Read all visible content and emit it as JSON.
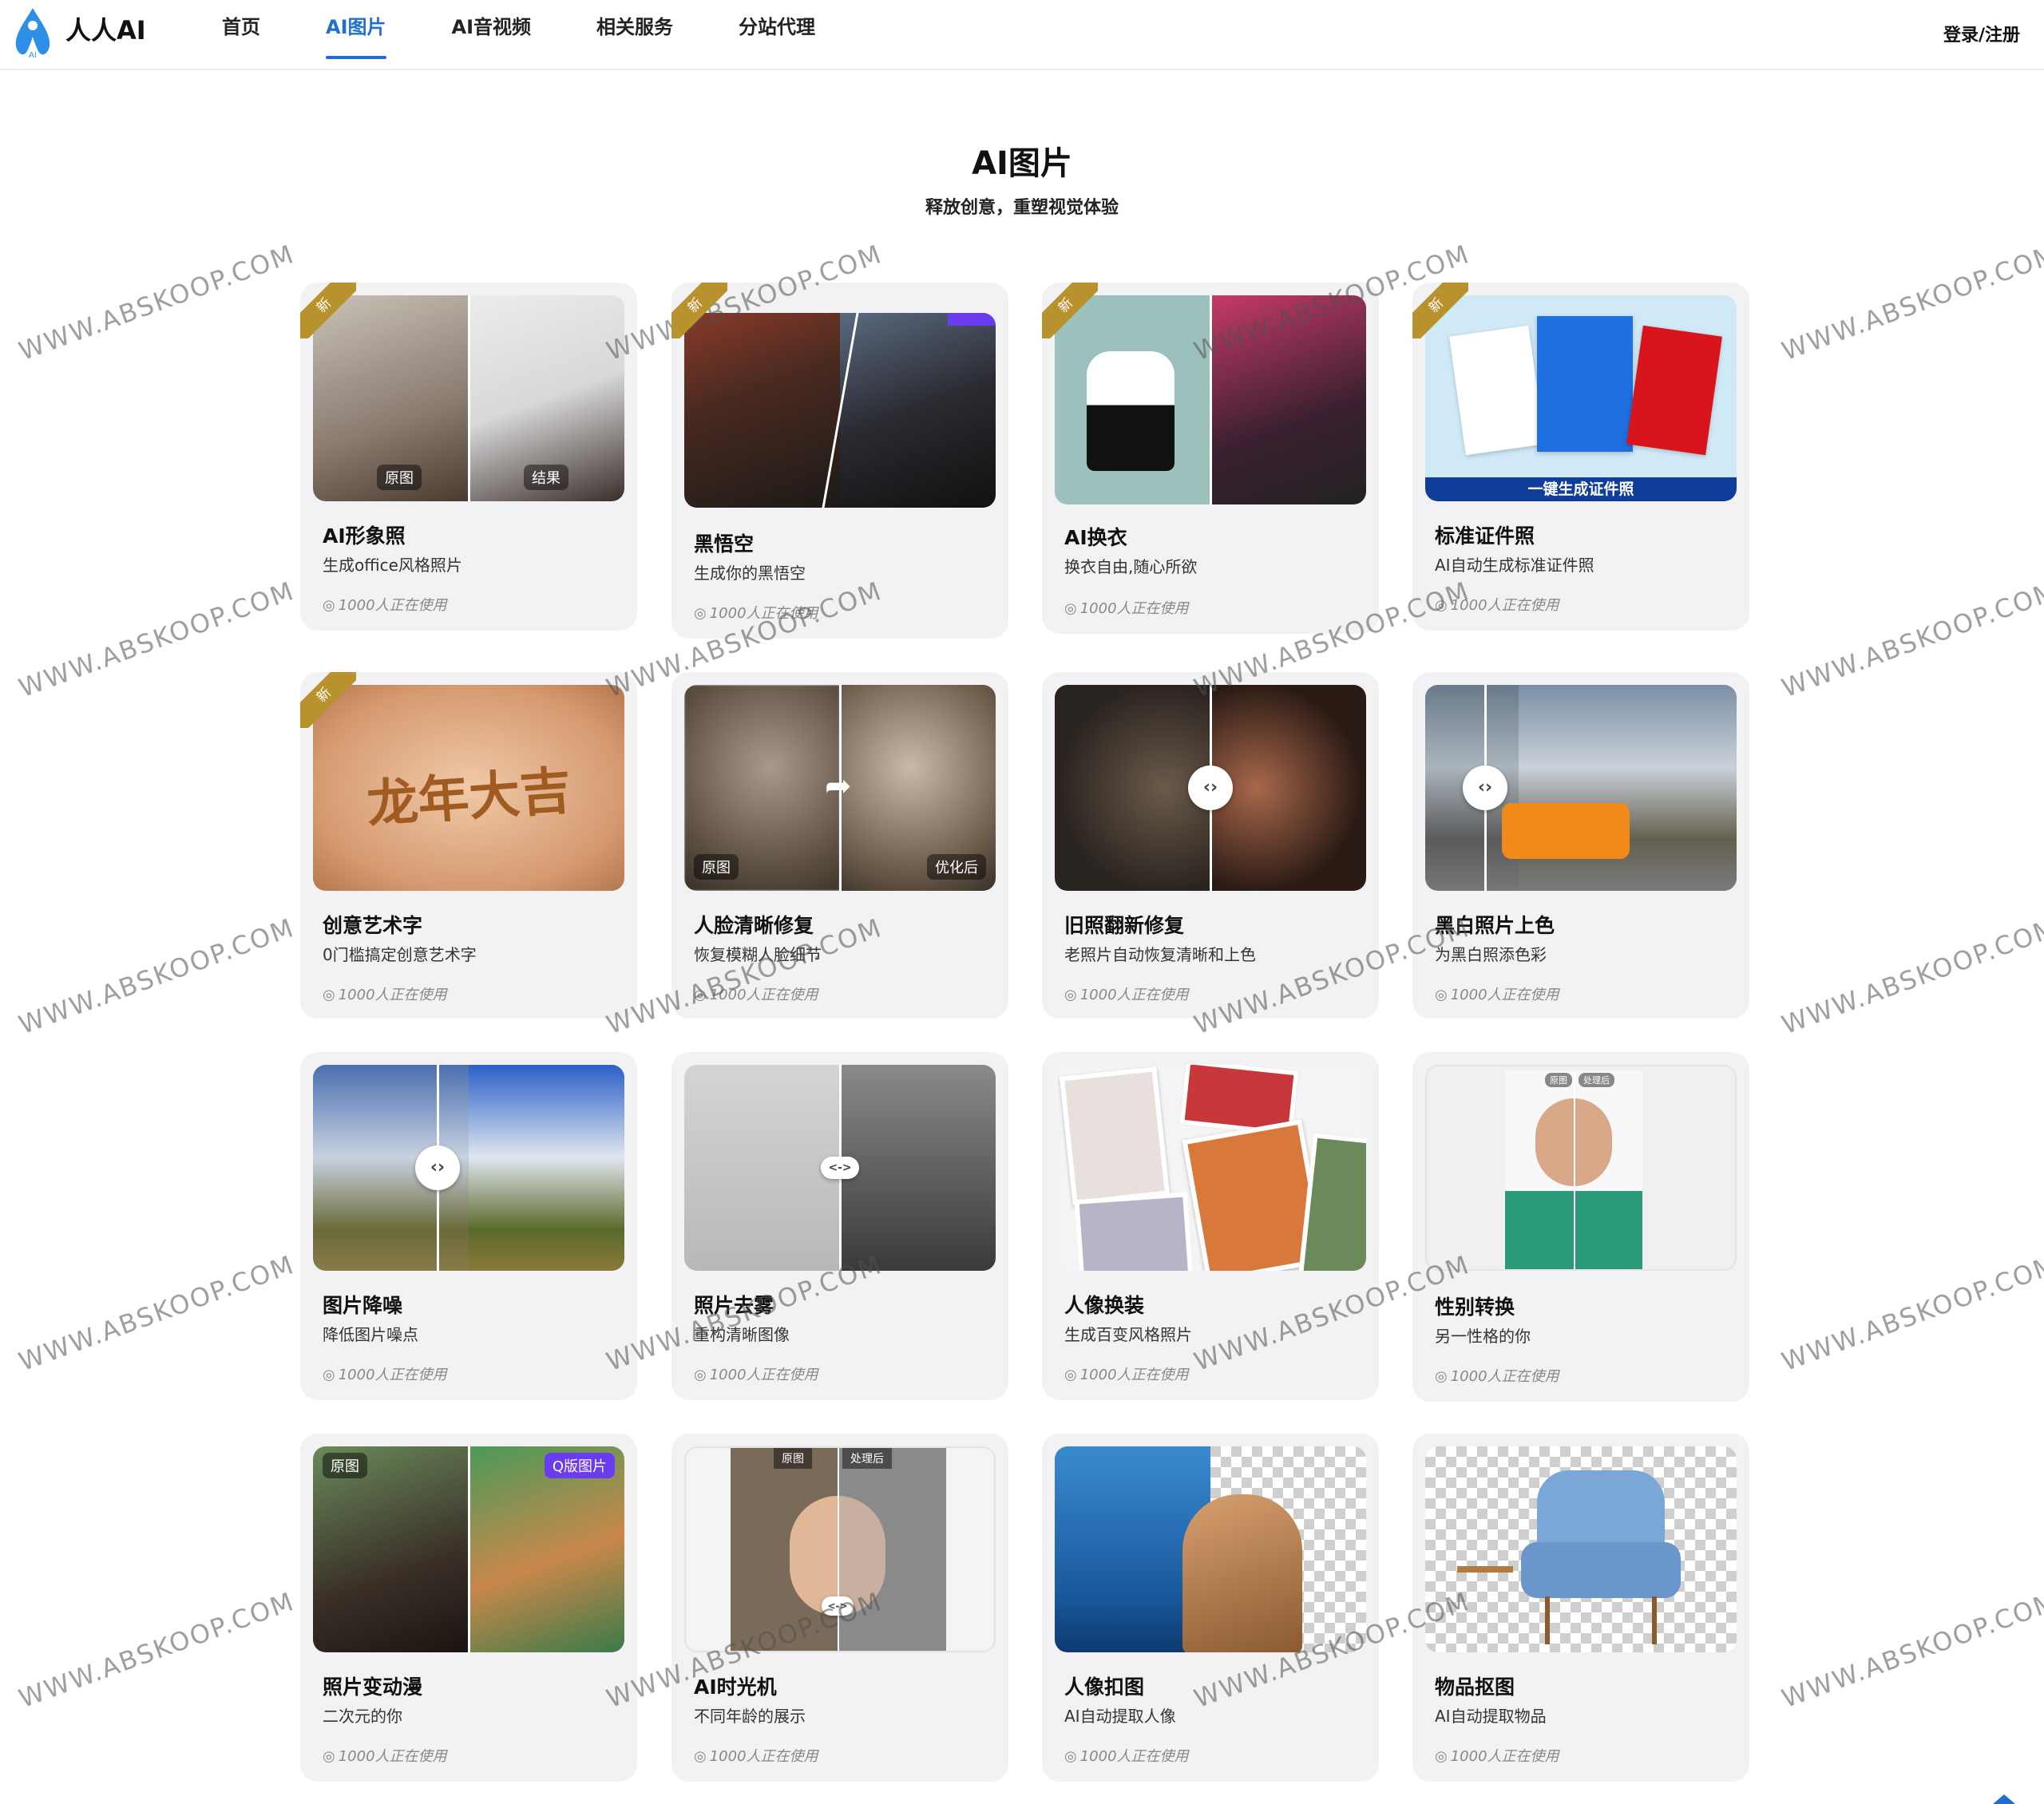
{
  "header": {
    "logo_text": "人人AI",
    "logo_badge": "AI",
    "nav": [
      {
        "label": "首页",
        "active": false
      },
      {
        "label": "AI图片",
        "active": true
      },
      {
        "label": "AI音视频",
        "active": false
      },
      {
        "label": "相关服务",
        "active": false
      },
      {
        "label": "分站代理",
        "active": false
      }
    ],
    "login": "登录/注册"
  },
  "hero": {
    "title": "AI图片",
    "subtitle": "释放创意，重塑视觉体验"
  },
  "badge_new": "新",
  "cards": [
    {
      "title": "AI形象照",
      "desc": "生成office风格照片",
      "usage": "1000人正在使用",
      "tags": [
        "原图",
        "结果"
      ]
    },
    {
      "title": "黑悟空",
      "desc": "生成你的黑悟空",
      "usage": "1000人正在使用",
      "tags": []
    },
    {
      "title": "AI换衣",
      "desc": "换衣自由,随心所欲",
      "usage": "1000人正在使用",
      "tags": []
    },
    {
      "title": "标准证件照",
      "desc": "AI自动生成标准证件照",
      "usage": "1000人正在使用",
      "banner": "一键生成证件照"
    },
    {
      "title": "创意艺术字",
      "desc": "0门槛搞定创意艺术字",
      "usage": "1000人正在使用",
      "art": "龙年大吉"
    },
    {
      "title": "人脸清晰修复",
      "desc": "恢复模糊人脸细节",
      "usage": "1000人正在使用",
      "tags": [
        "原图",
        "优化后"
      ]
    },
    {
      "title": "旧照翻新修复",
      "desc": "老照片自动恢复清晰和上色",
      "usage": "1000人正在使用"
    },
    {
      "title": "黑白照片上色",
      "desc": "为黑白照添色彩",
      "usage": "1000人正在使用"
    },
    {
      "title": "图片降噪",
      "desc": "降低图片噪点",
      "usage": "1000人正在使用"
    },
    {
      "title": "照片去雾",
      "desc": "重构清晰图像",
      "usage": "1000人正在使用"
    },
    {
      "title": "人像换装",
      "desc": "生成百变风格照片",
      "usage": "1000人正在使用"
    },
    {
      "title": "性别转换",
      "desc": "另一性格的你",
      "usage": "1000人正在使用",
      "tags": [
        "原图",
        "处理后"
      ]
    },
    {
      "title": "照片变动漫",
      "desc": "二次元的你",
      "usage": "1000人正在使用",
      "tags": [
        "原图",
        "Q版图片"
      ]
    },
    {
      "title": "AI时光机",
      "desc": "不同年龄的展示",
      "usage": "1000人正在使用",
      "tags": [
        "原图",
        "处理后"
      ]
    },
    {
      "title": "人像扣图",
      "desc": "AI自动提取人像",
      "usage": "1000人正在使用"
    },
    {
      "title": "物品抠图",
      "desc": "AI自动提取物品",
      "usage": "1000人正在使用"
    }
  ],
  "watermark": "WWW.ABSKOOP.COM",
  "colors": {
    "accent": "#1f6fd1",
    "card_bg": "#f2f2f4",
    "ribbon": "#b8922c"
  }
}
